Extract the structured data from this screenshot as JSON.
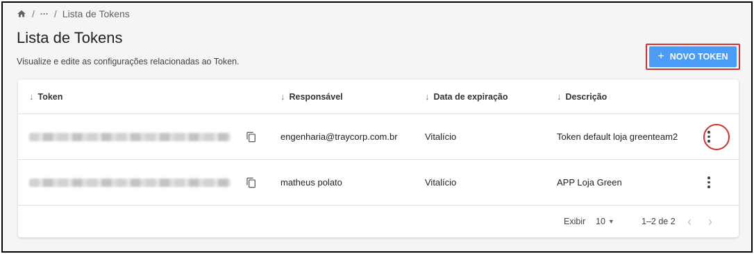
{
  "breadcrumb": {
    "home_icon": "home-icon",
    "ellipsis": "···",
    "current": "Lista de Tokens"
  },
  "page": {
    "title": "Lista de Tokens",
    "subtitle": "Visualize e edite as configurações relacionadas ao Token."
  },
  "actions": {
    "new_token_label": "NOVO TOKEN",
    "new_token_icon": "+"
  },
  "table": {
    "columns": [
      "Token",
      "Responsável",
      "Data de expiração",
      "Descrição"
    ],
    "sort_icon": "↓",
    "rows": [
      {
        "responsavel": "engenharia@traycorp.com.br",
        "expiracao": "Vitalício",
        "descricao": "Token default loja greenteam2"
      },
      {
        "responsavel": "matheus polato",
        "expiracao": "Vitalício",
        "descricao": "APP Loja Green"
      }
    ]
  },
  "pagination": {
    "show_label": "Exibir",
    "per_page": "10",
    "range": "1–2 de 2",
    "prev": "‹",
    "next": "›"
  },
  "colors": {
    "primary_button": "#4a9cf6",
    "highlight": "#d32f2f"
  }
}
